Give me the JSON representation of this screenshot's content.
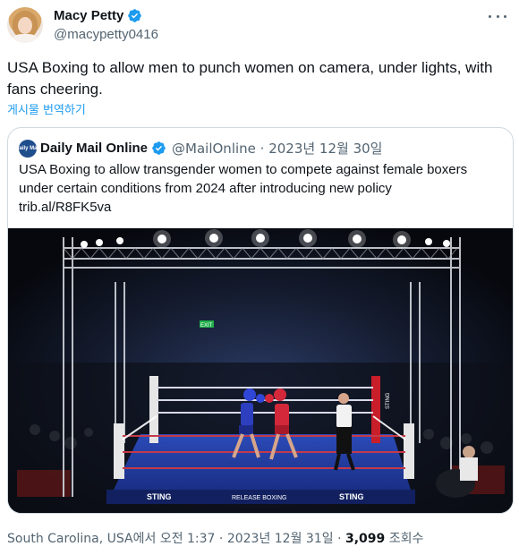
{
  "author": {
    "display_name": "Macy Petty",
    "handle": "@macypetty0416",
    "verified_color": "#1d9bf0"
  },
  "tweet": {
    "text": "USA Boxing to allow men to punch women on camera, under lights, with fans cheering.",
    "translate_label": "게시물 번역하기"
  },
  "quote": {
    "avatar_text": "Daily Mail",
    "display_name": "Daily Mail Online",
    "handle_date": "@MailOnline · 2023년 12월 30일",
    "text_lines": [
      "USA Boxing to allow transgender women to compete against female boxers",
      "under certain conditions from 2024 after introducing new policy",
      "trib.al/R8FK5va"
    ],
    "media": {
      "ring_banner_left": "STING",
      "ring_banner_right": "STING",
      "corner_post": "STING",
      "apron_center": "RELEASE BOXING",
      "exit_sign": "EXIT"
    }
  },
  "footer": {
    "meta": "South Carolina, USA에서 오전 1:37 · 2023년 12월 31일 · ",
    "views_count": "3,099",
    "views_label": " 조회수"
  },
  "icons": {
    "verified": "verified-badge-icon",
    "more": "more-options-icon"
  }
}
